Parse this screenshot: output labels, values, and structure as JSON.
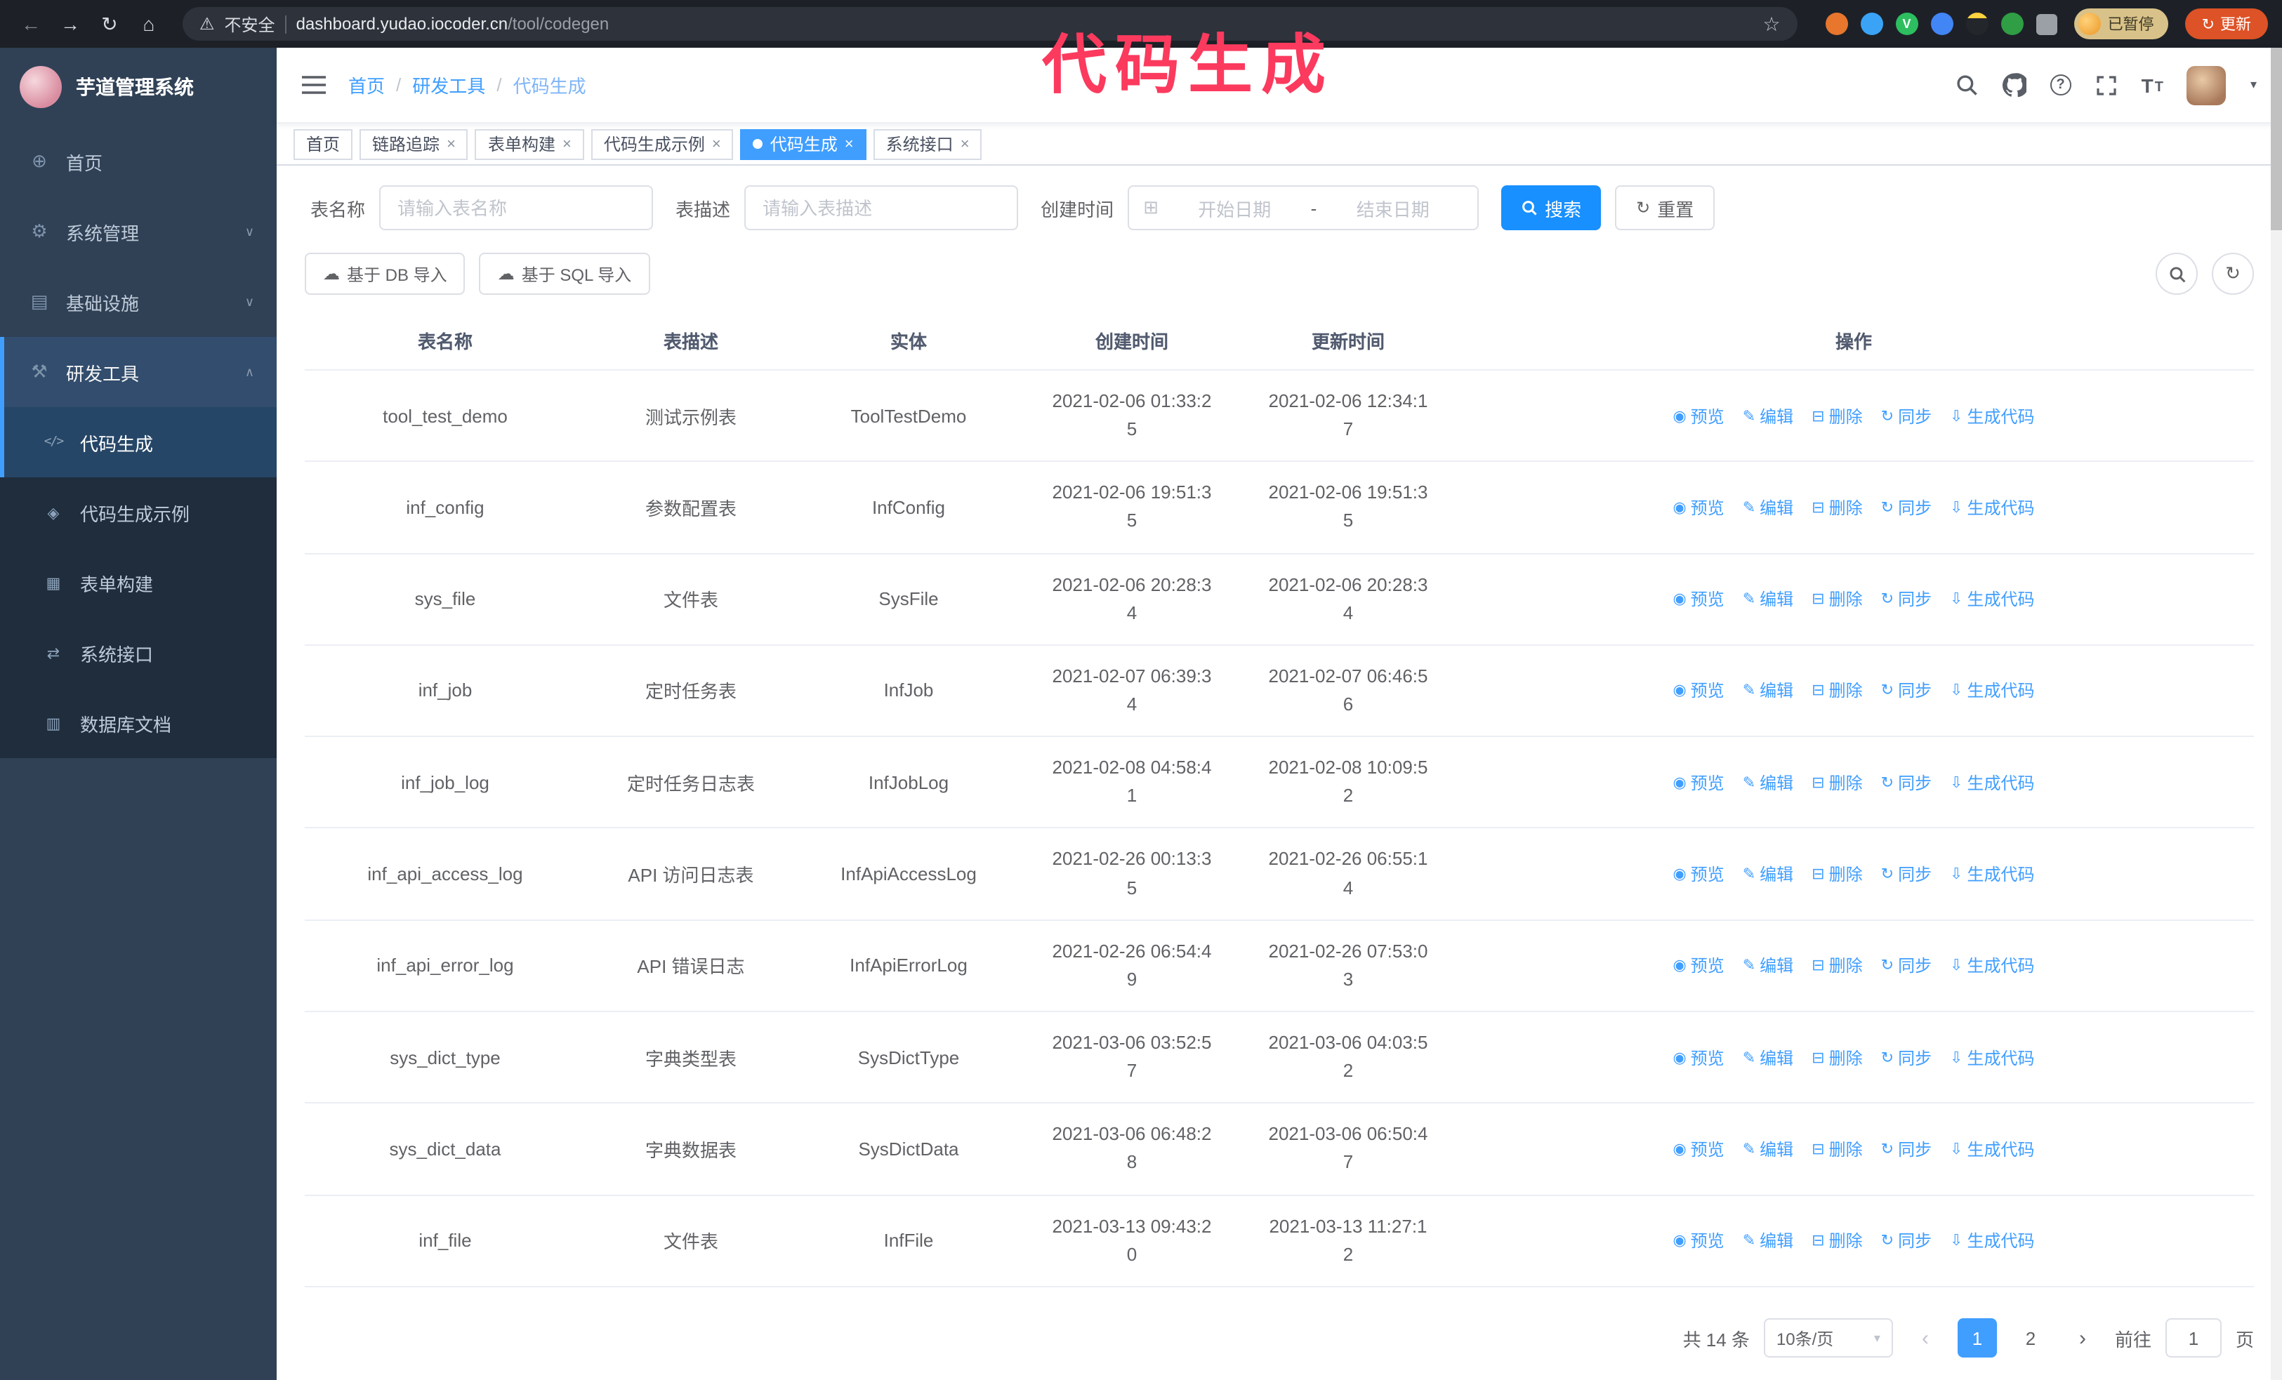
{
  "colors": {
    "accent_blue": "#409eff",
    "primary_button_blue": "#1890ff",
    "annotation_pink": "#fb3a5e",
    "sidebar_bg": "#304156",
    "submenu_bg": "#1f2d3d",
    "update_button_orange": "#dd5226"
  },
  "annotation": {
    "text": "代码生成"
  },
  "browser": {
    "security_label": "不安全",
    "url_host": "dashboard.yudao.iocoder.cn",
    "url_path": "/tool/codegen",
    "ext_badge": "V",
    "paused_label": "已暂停",
    "update_label": "更新"
  },
  "icons": {
    "back": "←",
    "forward": "→",
    "reload": "↻",
    "home": "⌂",
    "warning": "⚠",
    "star": "☆",
    "close": "×",
    "chevron_down": "∨",
    "chevron_up": "∧",
    "caret_down": "▾",
    "calendar": "⊞",
    "cloud_upload": "☁",
    "refresh": "↻",
    "prev": "‹",
    "next": "›",
    "question": "?",
    "font_size": "T",
    "menu_home": "⊕",
    "menu_system": "⚙",
    "menu_infra": "▤",
    "menu_tools": "⚒",
    "sub_codegen": "</>",
    "sub_example": "◈",
    "sub_form": "▦",
    "sub_api": "⇄",
    "sub_db": "▥"
  },
  "sidebar": {
    "title": "芋道管理系统",
    "items": [
      {
        "label": "首页"
      },
      {
        "label": "系统管理"
      },
      {
        "label": "基础设施"
      },
      {
        "label": "研发工具"
      }
    ],
    "sub": [
      {
        "label": "代码生成"
      },
      {
        "label": "代码生成示例"
      },
      {
        "label": "表单构建"
      },
      {
        "label": "系统接口"
      },
      {
        "label": "数据库文档"
      }
    ]
  },
  "header": {
    "breadcrumb": [
      "首页",
      "研发工具",
      "代码生成"
    ],
    "separator": "/"
  },
  "tabs": [
    {
      "label": "首页"
    },
    {
      "label": "链路追踪"
    },
    {
      "label": "表单构建"
    },
    {
      "label": "代码生成示例"
    },
    {
      "label": "代码生成"
    },
    {
      "label": "系统接口"
    }
  ],
  "filters": {
    "table_name_label": "表名称",
    "table_name_placeholder": "请输入表名称",
    "table_desc_label": "表描述",
    "table_desc_placeholder": "请输入表描述",
    "create_time_label": "创建时间",
    "start_placeholder": "开始日期",
    "range_separator": "-",
    "end_placeholder": "结束日期",
    "search_label": "搜索",
    "reset_label": "重置"
  },
  "toolbar": {
    "import_db_label": "基于 DB 导入",
    "import_sql_label": "基于 SQL 导入"
  },
  "table": {
    "columns": [
      "表名称",
      "表描述",
      "实体",
      "创建时间",
      "更新时间",
      "操作"
    ],
    "actions": [
      {
        "name": "preview",
        "label": "预览",
        "glyph": "◉"
      },
      {
        "name": "edit",
        "label": "编辑",
        "glyph": "✎"
      },
      {
        "name": "delete",
        "label": "删除",
        "glyph": "⊟"
      },
      {
        "name": "sync",
        "label": "同步",
        "glyph": "↻"
      },
      {
        "name": "generate-code",
        "label": "生成代码",
        "glyph": "⇩"
      }
    ],
    "rows": [
      {
        "name": "tool_test_demo",
        "desc": "测试示例表",
        "entity": "ToolTestDemo",
        "created": "2021-02-06 01:33:25",
        "updated": "2021-02-06 12:34:17"
      },
      {
        "name": "inf_config",
        "desc": "参数配置表",
        "entity": "InfConfig",
        "created": "2021-02-06 19:51:35",
        "updated": "2021-02-06 19:51:35"
      },
      {
        "name": "sys_file",
        "desc": "文件表",
        "entity": "SysFile",
        "created": "2021-02-06 20:28:34",
        "updated": "2021-02-06 20:28:34"
      },
      {
        "name": "inf_job",
        "desc": "定时任务表",
        "entity": "InfJob",
        "created": "2021-02-07 06:39:34",
        "updated": "2021-02-07 06:46:56"
      },
      {
        "name": "inf_job_log",
        "desc": "定时任务日志表",
        "entity": "InfJobLog",
        "created": "2021-02-08 04:58:41",
        "updated": "2021-02-08 10:09:52"
      },
      {
        "name": "inf_api_access_log",
        "desc": "API 访问日志表",
        "entity": "InfApiAccessLog",
        "created": "2021-02-26 00:13:35",
        "updated": "2021-02-26 06:55:14"
      },
      {
        "name": "inf_api_error_log",
        "desc": "API 错误日志",
        "entity": "InfApiErrorLog",
        "created": "2021-02-26 06:54:49",
        "updated": "2021-02-26 07:53:03"
      },
      {
        "name": "sys_dict_type",
        "desc": "字典类型表",
        "entity": "SysDictType",
        "created": "2021-03-06 03:52:57",
        "updated": "2021-03-06 04:03:52"
      },
      {
        "name": "sys_dict_data",
        "desc": "字典数据表",
        "entity": "SysDictData",
        "created": "2021-03-06 06:48:28",
        "updated": "2021-03-06 06:50:47"
      },
      {
        "name": "inf_file",
        "desc": "文件表",
        "entity": "InfFile",
        "created": "2021-03-13 09:43:20",
        "updated": "2021-03-13 11:27:12"
      }
    ]
  },
  "pagination": {
    "total": "共 14 条",
    "page_size": "10条/页",
    "pages": [
      "1",
      "2"
    ],
    "goto_label": "前往",
    "goto_value": "1",
    "page_unit": "页"
  }
}
